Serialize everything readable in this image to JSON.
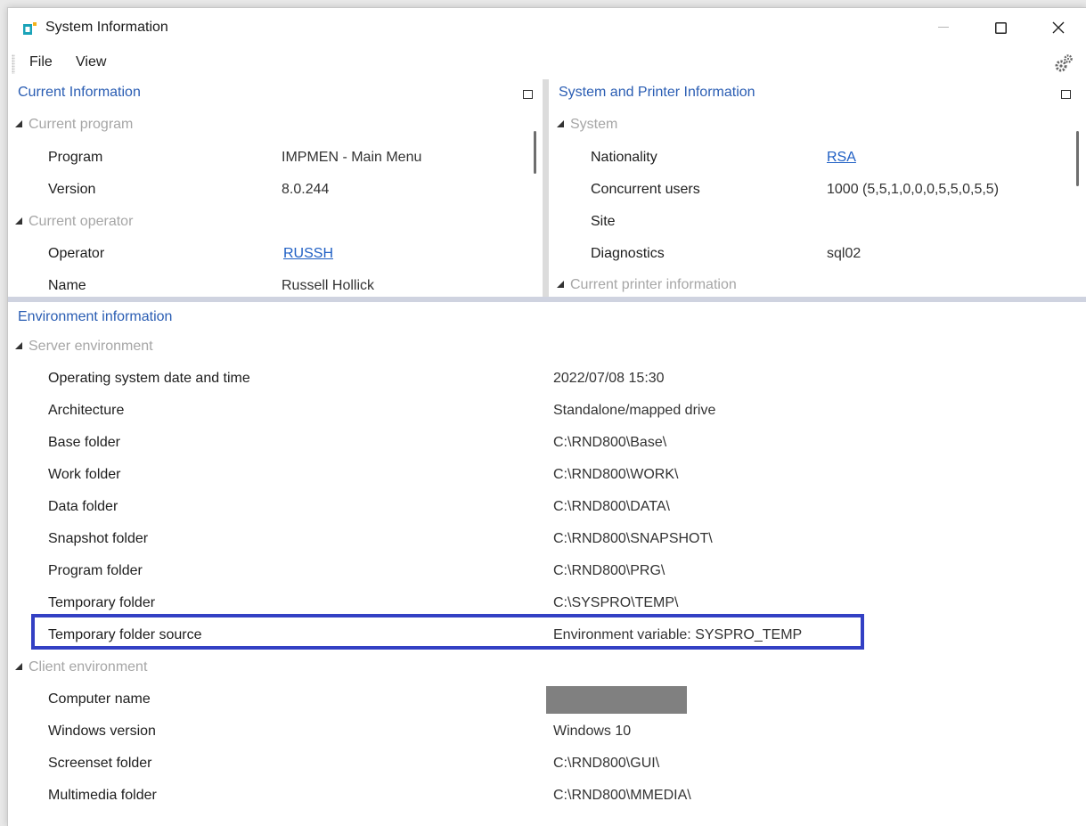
{
  "window": {
    "title": "System Information"
  },
  "menu": {
    "file": "File",
    "view": "View"
  },
  "current_info": {
    "header": "Current Information",
    "groups": [
      {
        "title": "Current program",
        "rows": [
          {
            "label": "Program",
            "value": "IMPMEN - Main Menu"
          },
          {
            "label": "Version",
            "value": "8.0.244"
          }
        ]
      },
      {
        "title": "Current operator",
        "rows": [
          {
            "label": "Operator",
            "value": "RUSSH"
          },
          {
            "label": "Name",
            "value": "Russell Hollick"
          }
        ]
      }
    ]
  },
  "system_info": {
    "header": "System and Printer Information",
    "groups": [
      {
        "title": "System",
        "rows": [
          {
            "label": "Nationality",
            "value": "RSA"
          },
          {
            "label": "Concurrent users",
            "value": "1000 (5,5,1,0,0,0,5,5,0,5,5)"
          },
          {
            "label": "Site",
            "value": ""
          },
          {
            "label": "Diagnostics",
            "value": "sql02"
          }
        ]
      },
      {
        "title": "Current printer information",
        "rows": []
      }
    ]
  },
  "environment": {
    "header": "Environment information",
    "server": {
      "title": "Server environment",
      "rows": [
        {
          "label": "Operating system date and time",
          "value": "2022/07/08 15:30"
        },
        {
          "label": "Architecture",
          "value": "Standalone/mapped drive"
        },
        {
          "label": "Base folder",
          "value": "C:\\RND800\\Base\\"
        },
        {
          "label": "Work folder",
          "value": "C:\\RND800\\WORK\\"
        },
        {
          "label": "Data folder",
          "value": "C:\\RND800\\DATA\\"
        },
        {
          "label": "Snapshot folder",
          "value": "C:\\RND800\\SNAPSHOT\\"
        },
        {
          "label": "Program folder",
          "value": "C:\\RND800\\PRG\\"
        },
        {
          "label": "Temporary folder",
          "value": "C:\\SYSPRO\\TEMP\\"
        },
        {
          "label": "Temporary folder source",
          "value": "Environment variable: SYSPRO_TEMP"
        }
      ]
    },
    "client": {
      "title": "Client environment",
      "rows": [
        {
          "label": "Computer name",
          "value": ""
        },
        {
          "label": "Windows version",
          "value": "Windows 10"
        },
        {
          "label": "Screenset folder",
          "value": "C:\\RND800\\GUI\\"
        },
        {
          "label": "Multimedia folder",
          "value": "C:\\RND800\\MMEDIA\\"
        }
      ]
    }
  },
  "colors": {
    "header": "#2a5db3",
    "group": "#a6a6a6",
    "link": "#1f5fc4",
    "highlight": "#3340c4"
  },
  "icons": [
    "app-icon",
    "minimize-icon",
    "maximize-icon",
    "close-icon",
    "gear-icon",
    "restore-icon",
    "expand-triangle-icon"
  ]
}
